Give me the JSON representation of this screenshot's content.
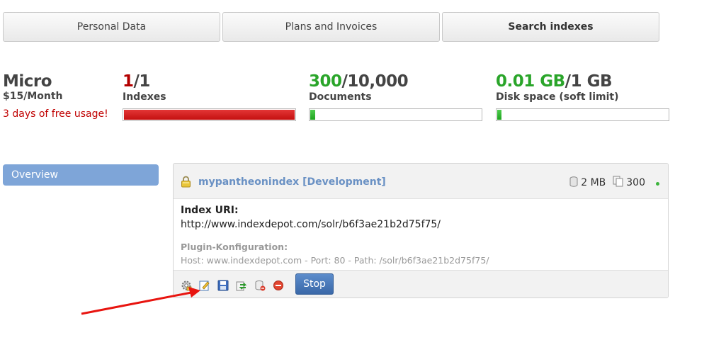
{
  "tabs": [
    {
      "label": "Personal Data"
    },
    {
      "label": "Plans and Invoices"
    },
    {
      "label": "Search indexes"
    }
  ],
  "plan": {
    "name": "Micro",
    "price": "$15/Month",
    "trial": "3 days of free usage!"
  },
  "stats": {
    "indexes": {
      "used": "1",
      "total": "/1",
      "label": "Indexes",
      "fill_fraction": 1.0
    },
    "documents": {
      "used": "300",
      "total": "/10,000",
      "label": "Documents",
      "fill_fraction": 0.03
    },
    "disk": {
      "used": "0.01 GB",
      "total": "/1 GB",
      "label": "Disk space (soft limit)",
      "fill_fraction": 0.01
    }
  },
  "sidebar": {
    "overview": "Overview"
  },
  "index": {
    "name": "mypantheonindex [Development]",
    "size": "2 MB",
    "documents": "300",
    "status_color": "#3cb43c",
    "uri_label": "Index URI:",
    "uri": "http://www.indexdepot.com/solr/b6f3ae21b2d75f75/",
    "plugin_label": "Plugin-Konfiguration:",
    "plugin_text": "Host: www.indexdepot.com - Port: 80 - Path: /solr/b6f3ae21b2d75f75/",
    "toolbar_icons": [
      "settings-icon",
      "edit-icon",
      "save-icon",
      "reload-icon",
      "delete-data-icon",
      "remove-icon"
    ],
    "stop_label": "Stop"
  },
  "colors": {
    "accent_blue": "#7ea5d8",
    "danger_red": "#c41010",
    "success_green": "#2aa52a"
  }
}
